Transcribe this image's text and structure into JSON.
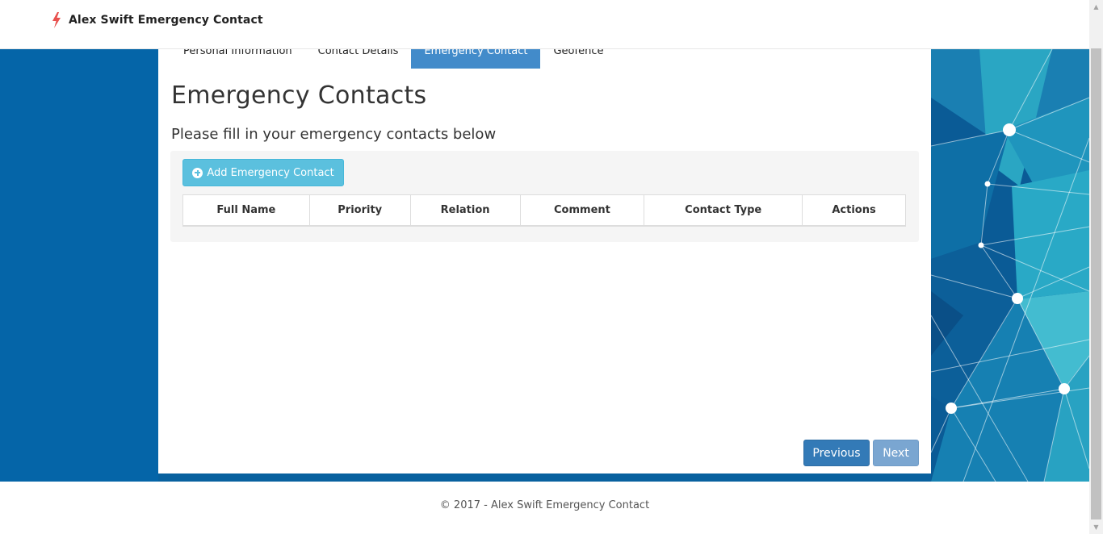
{
  "app": {
    "brand_title": "Alex Swift Emergency Contact",
    "accent_color": "#428bca",
    "logo_icon": "bolt-icon"
  },
  "tabs": [
    {
      "label": "Personal Information",
      "active": false
    },
    {
      "label": "Contact Details",
      "active": false
    },
    {
      "label": "Emergency Contact",
      "active": true
    },
    {
      "label": "Geofence",
      "active": false
    }
  ],
  "main": {
    "title": "Emergency Contacts",
    "subtitle": "Please fill in your emergency contacts below",
    "add_button_label": "Add Emergency Contact",
    "add_button_icon": "plus-circle-icon",
    "table": {
      "columns": [
        "Full Name",
        "Priority",
        "Relation",
        "Comment",
        "Contact Type",
        "Actions"
      ],
      "rows": []
    }
  },
  "nav": {
    "previous_label": "Previous",
    "next_label": "Next"
  },
  "footer": {
    "text": "© 2017 - Alex Swift Emergency Contact"
  },
  "colors": {
    "background_blue": "#0565a8",
    "info_button": "#5bc0de",
    "primary_button": "#337ab7",
    "disabled_button": "#7aa6d1"
  }
}
